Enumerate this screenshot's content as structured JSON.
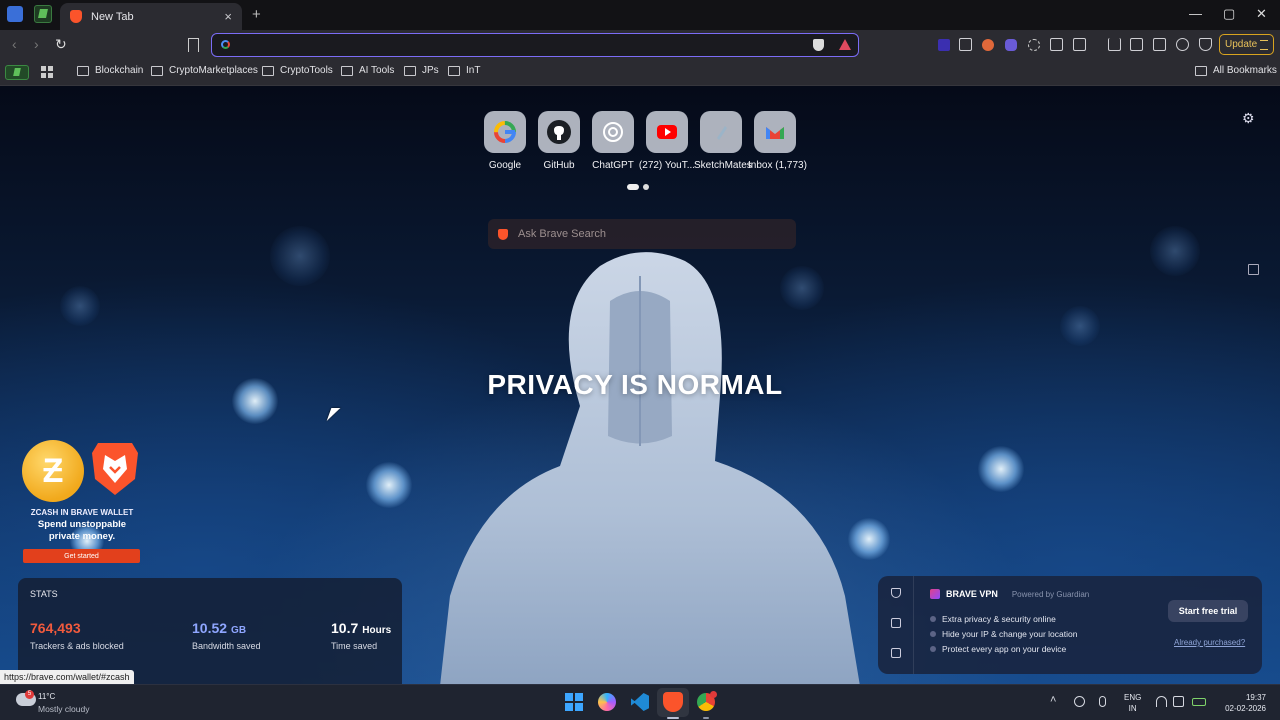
{
  "browser": {
    "tab_title": "New Tab",
    "tab_close": "×",
    "new_tab": "+",
    "window_controls": {
      "minimize": "—",
      "maximize": "▢",
      "close": "✕"
    },
    "nav": {
      "back": "‹",
      "forward": "›",
      "reload": "↻"
    },
    "omnibox": {
      "value": "",
      "placeholder": ""
    },
    "update_label": "Update"
  },
  "bookmarks": {
    "folders": [
      "Blockchain",
      "CryptoMarketplaces",
      "CryptoTools",
      "AI Tools",
      "JPs",
      "InT"
    ],
    "all_bookmarks": "All Bookmarks"
  },
  "ntp": {
    "top_sites": [
      {
        "label": "Google",
        "icon": "google-icon"
      },
      {
        "label": "GitHub",
        "icon": "github-icon"
      },
      {
        "label": "ChatGPT",
        "icon": "chatgpt-icon"
      },
      {
        "label": "(272) YouT...",
        "icon": "youtube-icon"
      },
      {
        "label": "SketchMates",
        "icon": "sketchmates-icon"
      },
      {
        "label": "Inbox (1,773)",
        "icon": "gmail-icon"
      }
    ],
    "search_placeholder": "Ask Brave Search",
    "hero_text": "PRIVACY IS NORMAL",
    "wallet_promo": {
      "title": "ZCASH IN BRAVE WALLET",
      "subtitle": "Spend unstoppable private money.",
      "button": "Get started"
    },
    "stats": {
      "heading": "STATS",
      "trackers_value": "764,493",
      "trackers_label": "Trackers & ads blocked",
      "bandwidth_value": "10.52",
      "bandwidth_unit": "GB",
      "bandwidth_label": "Bandwidth saved",
      "time_value": "10.7",
      "time_unit": "Hours",
      "time_label": "Time saved"
    },
    "vpn": {
      "title": "BRAVE VPN",
      "status": "Powered by Guardian",
      "features": [
        "Extra privacy & security online",
        "Hide your IP & change your location",
        "Protect every app on your device"
      ],
      "cta": "Start free trial",
      "already_purchased": "Already purchased?"
    },
    "status_url": "https://brave.com/wallet/#zcash"
  },
  "taskbar": {
    "weather_temp": "11°C",
    "weather_desc": "Mostly cloudy",
    "weather_badge": "5",
    "lang_line1": "ENG",
    "lang_line2": "IN",
    "time": "19:37",
    "date": "02-02-2026"
  },
  "colors": {
    "accent_omnibox": "#7b6cf6",
    "brave_orange": "#fb542b",
    "trackers_value": "#f15a3d",
    "bandwidth_value": "#8fa6ff",
    "time_value": "#ffffff",
    "update_gold": "#d9a41f"
  }
}
